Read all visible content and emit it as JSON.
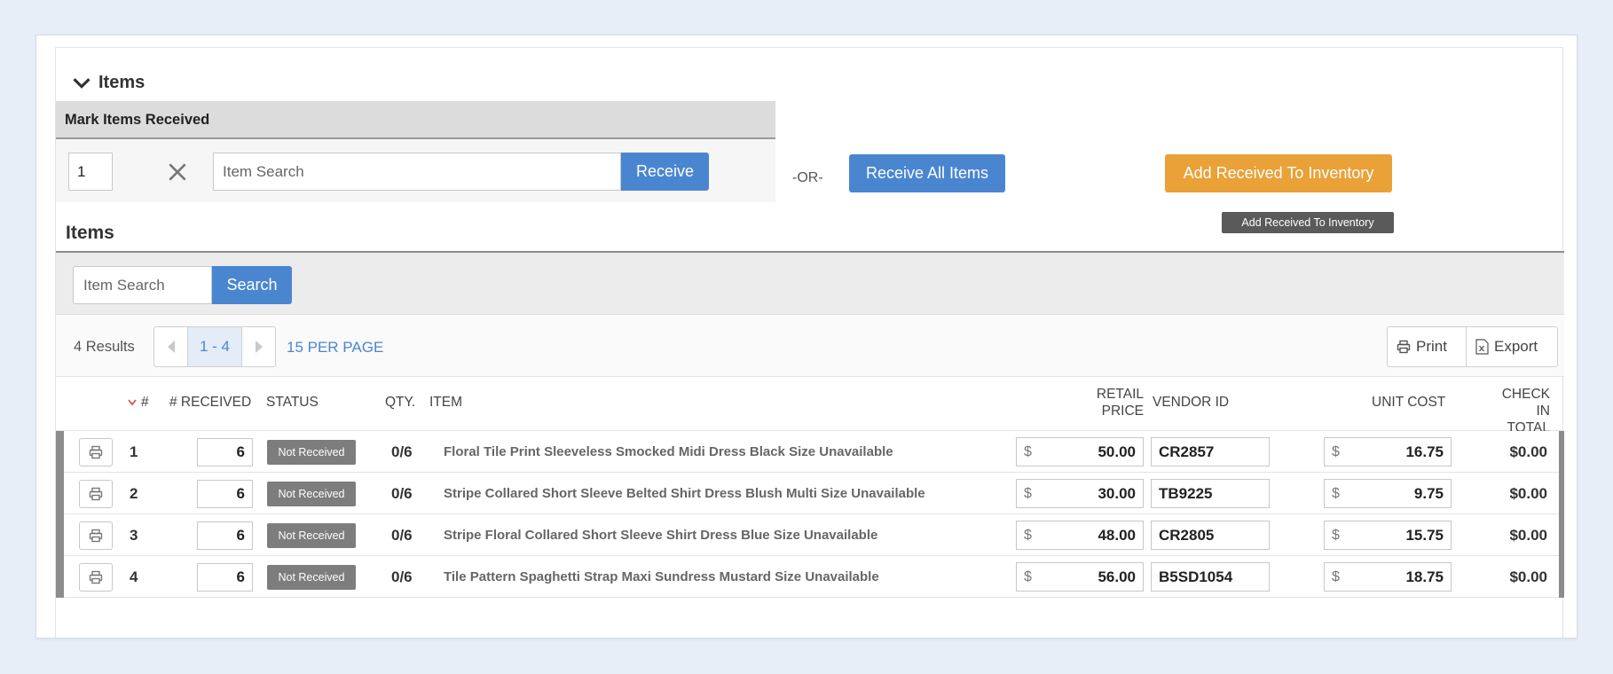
{
  "section": {
    "title": "Items"
  },
  "mark_received": {
    "header": "Mark Items Received",
    "qty_value": "1",
    "search_placeholder": "Item Search",
    "receive_label": "Receive",
    "or_label": "-OR-",
    "receive_all_label": "Receive All Items",
    "add_inventory_label": "Add Received To Inventory",
    "tooltip": "Add Received To Inventory"
  },
  "items": {
    "title": "Items",
    "search_placeholder": "Item Search",
    "search_label": "Search",
    "results": "4 Results",
    "page_range": "1 - 4",
    "per_page": "15 PER PAGE",
    "print_label": "Print",
    "export_label": "Export"
  },
  "columns": {
    "num": "#",
    "received": "# RECEIVED",
    "status": "STATUS",
    "qty": "QTY.",
    "item": "ITEM",
    "retail_1": "RETAIL",
    "retail_2": "PRICE",
    "vendor": "VENDOR ID",
    "unit_cost": "UNIT COST",
    "total_1": "CHECK IN",
    "total_2": "TOTAL"
  },
  "rows": [
    {
      "num": "1",
      "received": "6",
      "status": "Not Received",
      "qty": "0/6",
      "item": "Floral Tile Print Sleeveless Smocked Midi Dress Black Size Unavailable",
      "retail_price": "50.00",
      "vendor_id": "CR2857",
      "unit_cost": "16.75",
      "total": "$0.00"
    },
    {
      "num": "2",
      "received": "6",
      "status": "Not Received",
      "qty": "0/6",
      "item": "Stripe Collared Short Sleeve Belted Shirt Dress Blush Multi Size Unavailable",
      "retail_price": "30.00",
      "vendor_id": "TB9225",
      "unit_cost": "9.75",
      "total": "$0.00"
    },
    {
      "num": "3",
      "received": "6",
      "status": "Not Received",
      "qty": "0/6",
      "item": "Stripe Floral Collared Short Sleeve Shirt Dress Blue Size Unavailable",
      "retail_price": "48.00",
      "vendor_id": "CR2805",
      "unit_cost": "15.75",
      "total": "$0.00"
    },
    {
      "num": "4",
      "received": "6",
      "status": "Not Received",
      "qty": "0/6",
      "item": "Tile Pattern Spaghetti Strap Maxi Sundress Mustard Size Unavailable",
      "retail_price": "56.00",
      "vendor_id": "B5SD1054",
      "unit_cost": "18.75",
      "total": "$0.00"
    }
  ],
  "currency_symbol": "$",
  "colors": {
    "primary": "#4a86d0",
    "warning": "#e9a138",
    "badge": "#7d7d7d",
    "sort_active": "#d9534f"
  }
}
